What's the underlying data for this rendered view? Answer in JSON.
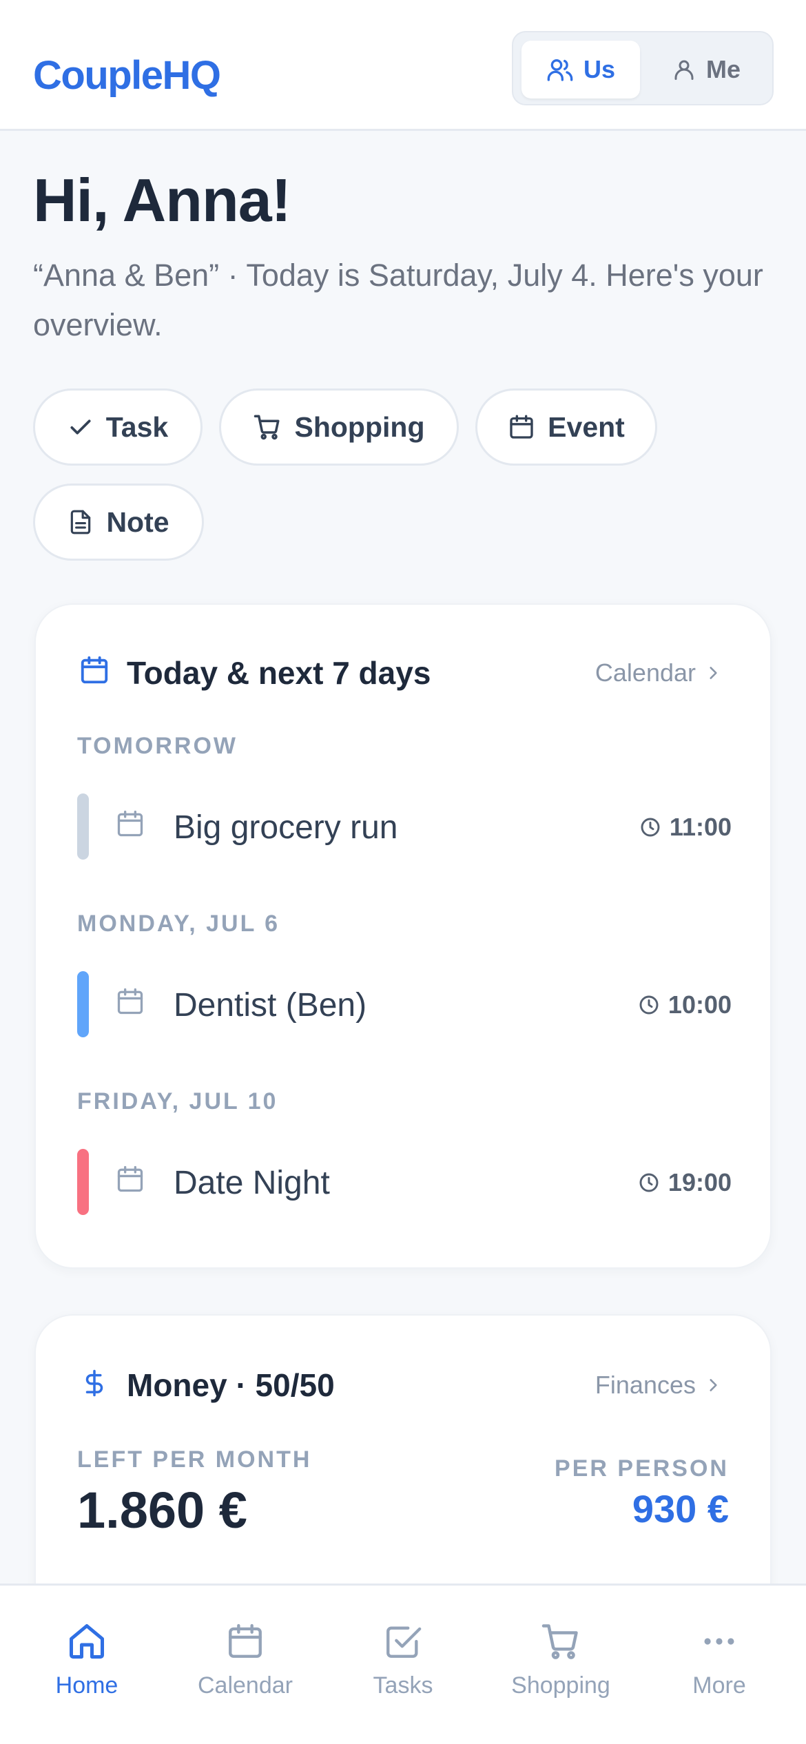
{
  "app": {
    "logo": "CoupleHQ",
    "accent_color": "#2f6fe4"
  },
  "view_toggle": {
    "us_label": "Us",
    "me_label": "Me",
    "selected": "Us"
  },
  "greeting": {
    "title": "Hi, Anna!",
    "subtitle": "“Anna & Ben” · Today is Saturday, July 4. Here's your overview."
  },
  "quick_add": [
    {
      "label": "Task",
      "icon": "check-icon"
    },
    {
      "label": "Shopping",
      "icon": "cart-icon"
    },
    {
      "label": "Event",
      "icon": "calendar-icon"
    },
    {
      "label": "Note",
      "icon": "note-icon"
    }
  ],
  "upcoming": {
    "title": "Today & next 7 days",
    "link_label": "Calendar",
    "days": [
      {
        "label": "TOMORROW",
        "events": [
          {
            "title": "Big grocery run",
            "time": "11:00",
            "color": "#cbd5e1"
          }
        ]
      },
      {
        "label": "MONDAY, JUL 6",
        "events": [
          {
            "title": "Dentist (Ben)",
            "time": "10:00",
            "color": "#60a5fa"
          }
        ]
      },
      {
        "label": "FRIDAY, JUL 10",
        "events": [
          {
            "title": "Date Night",
            "time": "19:00",
            "color": "#f87181"
          }
        ]
      }
    ]
  },
  "money": {
    "title": "Money · 50/50",
    "link_label": "Finances",
    "left_label": "LEFT PER MONTH",
    "left_value": "1.860 €",
    "per_person_label": "PER PERSON",
    "per_person_value": "930 €"
  },
  "bottom_nav": [
    {
      "label": "Home",
      "icon": "home-icon",
      "active": true
    },
    {
      "label": "Calendar",
      "icon": "calendar-icon",
      "active": false
    },
    {
      "label": "Tasks",
      "icon": "tasks-icon",
      "active": false
    },
    {
      "label": "Shopping",
      "icon": "cart-icon",
      "active": false
    },
    {
      "label": "More",
      "icon": "more-icon",
      "active": false
    }
  ]
}
